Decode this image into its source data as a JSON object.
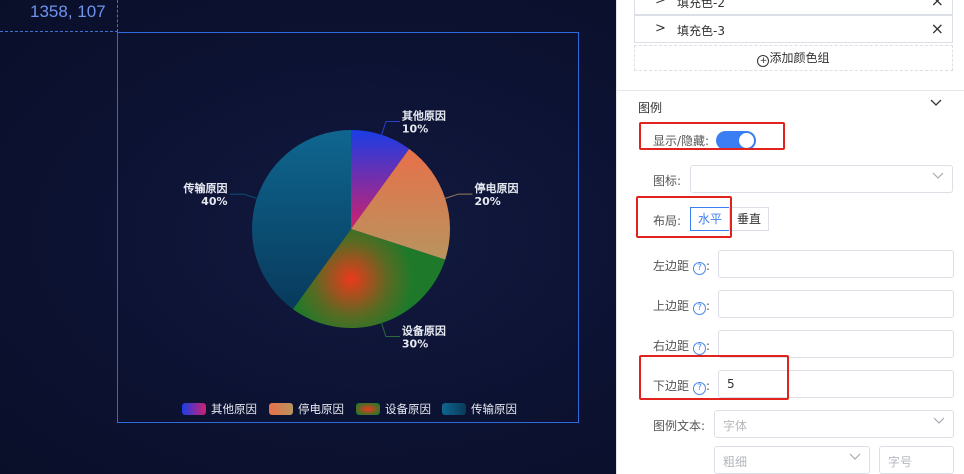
{
  "canvas": {
    "coordinate_readout": "1358, 107"
  },
  "chart_data": {
    "type": "pie",
    "slices": [
      {
        "name": "其他原因",
        "value": 10,
        "label": "10%"
      },
      {
        "name": "停电原因",
        "value": 20,
        "label": "20%"
      },
      {
        "name": "设备原因",
        "value": 30,
        "label": "30%"
      },
      {
        "name": "传输原因",
        "value": 40,
        "label": "40%"
      }
    ],
    "legend": [
      "其他原因",
      "停电原因",
      "设备原因",
      "传输原因"
    ],
    "legend_placement": "bottom-center",
    "colors": {
      "其他原因": [
        "#1a3de6",
        "#d0206e"
      ],
      "停电原因": [
        "#e8704a",
        "#b8945e"
      ],
      "设备原因": [
        "#ea3a1c",
        "#1e7a2a"
      ],
      "传输原因": [
        "#0f6690",
        "#083a5c"
      ]
    }
  },
  "panel": {
    "fill_rows": [
      {
        "name": "填充色-2",
        "chevron": "chevron-right-icon",
        "close": "×"
      },
      {
        "name": "填充色-3",
        "chevron": "chevron-right-icon",
        "close": "×"
      }
    ],
    "add_color_group": "添加颜色组",
    "legend_section": {
      "title": "图例",
      "show_hide_label": "显示/隐藏:",
      "show_hide_on": true,
      "icon_label": "图标:",
      "icon_value": "",
      "layout_label": "布局:",
      "layout_options": [
        "水平",
        "垂直"
      ],
      "layout_selected": "水平",
      "left_margin_label": "左边距",
      "left_margin_value": "",
      "top_margin_label": "上边距",
      "top_margin_value": "",
      "right_margin_label": "右边距",
      "right_margin_value": "",
      "bottom_margin_label": "下边距",
      "bottom_margin_value": "5",
      "legend_text_label": "图例文本:",
      "font_placeholder": "字体",
      "weight_placeholder": "粗细",
      "size_placeholder": "字号",
      "colon": ":",
      "help": "?"
    },
    "accent_color": "#3b7ef3",
    "highlight_color": "#e0231c"
  }
}
